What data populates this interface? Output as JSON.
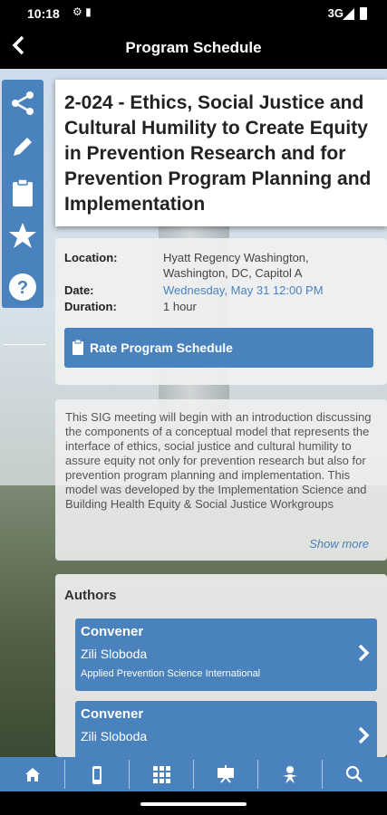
{
  "status_bar": {
    "time": "10:18",
    "network": "3G"
  },
  "app_bar": {
    "back_label": "‹",
    "title": "Program Schedule"
  },
  "side_toolbar": {
    "icons": [
      "share-icon",
      "edit-icon",
      "clipboard-icon",
      "star-icon",
      "help-icon"
    ]
  },
  "session": {
    "title": "2-024 - Ethics, Social Justice and Cultural Humility to Create Equity in Prevention Research and for Prevention Program Planning and Implementation",
    "location_label": "Location:",
    "location_value": "Hyatt Regency Washington, Washington, DC, Capitol A",
    "date_label": "Date:",
    "date_value": "Wednesday, May 31 12:00 PM",
    "duration_label": "Duration:",
    "duration_value": "1 hour",
    "rate_button": "Rate Program Schedule",
    "description": "This SIG meeting will begin with an introduction discussing the components of a conceptual model that represents the interface of ethics, social justice and cultural humility to assure equity not only for prevention research but also for prevention program planning and implementation. This model was developed by the Implementation Science and Building Health Equity & Social Justice Workgroups",
    "show_more": "Show more"
  },
  "authors": {
    "header": "Authors",
    "items": [
      {
        "role": "Convener",
        "name": "Zili Sloboda",
        "org": "Applied Prevention Science International"
      },
      {
        "role": "Convener",
        "name": "Zili Sloboda",
        "org": ""
      }
    ]
  },
  "bottom_nav": {
    "icons": [
      "home-icon",
      "phone-icon",
      "grid-icon",
      "presentation-icon",
      "people-icon",
      "search-icon"
    ]
  },
  "colors": {
    "accent": "#4a82be",
    "card": "#f0f0f0",
    "bar": "#000000"
  }
}
